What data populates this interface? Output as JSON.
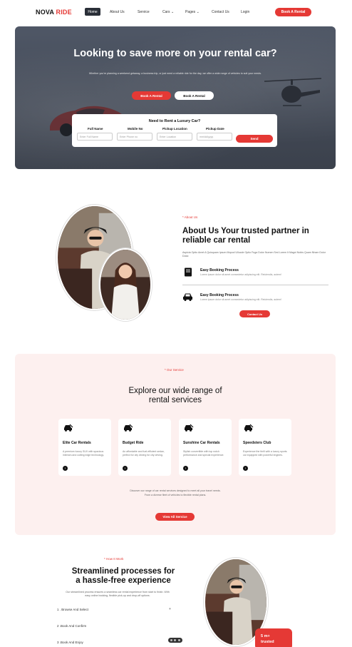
{
  "nav": {
    "logo_main": "NOVA",
    "logo_accent": "RIDE",
    "items": [
      "Home",
      "About Us",
      "Service",
      "Cars",
      "Pages",
      "Contact Us",
      "Login"
    ],
    "cta": "Book A Rental"
  },
  "hero": {
    "title": "Looking to save more on your rental car?",
    "subtitle": "Whether you're planning a weekend getaway, a business trip, or just need a reliable ride for the day, we offer a wide range of vehicles to suit your needs.",
    "btn_primary": "Book A Rental",
    "btn_secondary": "Book A Rental"
  },
  "booking": {
    "title": "Need to Rent a Luxury Car?",
    "fields": [
      {
        "label": "Full Name",
        "placeholder": "Enter Full Name"
      },
      {
        "label": "Mobile No",
        "placeholder": "Enter Phone no"
      },
      {
        "label": "Pickup Location",
        "placeholder": "Enter Location"
      },
      {
        "label": "Pickup Date",
        "placeholder": "mm/dd/yyyy"
      }
    ],
    "submit": "Send"
  },
  "about": {
    "tag": "* About Us",
    "title": "About Us Your trusted partner in reliable car rental",
    "text": "Aspicia Optio Amet A Quisquam Ipsum Mopod Ullucde Optio Fuga Dolor Numen Sed Lorem It Magni Nobis Quam Nham Dolor Dolor.",
    "features": [
      {
        "title": "Easy Booking Process",
        "text": "Lorem ipsum dolor sit amet consectetur adipiscing elit. Reiciendis, autem!"
      },
      {
        "title": "Easy Booking Process",
        "text": "Lorem ipsum dolor sit amet consectetur adipiscing elit. Reiciendis, autem!"
      }
    ],
    "button": "Contact Us"
  },
  "services": {
    "tag": "* Our Service",
    "title_line1": "Explore our wide range of",
    "title_line2": "rental services",
    "cards": [
      {
        "title": "Elite Car Rentals",
        "text": "A premium luxury SUV with spacious interiors and cutting edge technology."
      },
      {
        "title": "Budget Ride",
        "text": "An affordable and fuel-efficient sedan, perfect for city driving for city driving."
      },
      {
        "title": "Sunshine Car Rentals",
        "text": "Stylish convertible with top notch performance and special experience."
      },
      {
        "title": "Speedsters Club",
        "text": "Experience the thrill with a luxury sports car equipped with powerful engines."
      }
    ],
    "desc_line1": "Discover our range of car rental services designed to meet all your travel needs.",
    "desc_line2": "From a diverse fleet of vehicles to flexible rental plans.",
    "button": "View All Service"
  },
  "how": {
    "tag": "* How It Work",
    "title_line1": "Streamlined processes for",
    "title_line2": "a hassle-free experience",
    "desc": "Our streamlined process ensures a seamless car rental experience from start to finish. With easy online booking, flexible pick-up and drop-off options.",
    "steps": [
      "1 . Browse And Select",
      "2 .Book And Confirm",
      "3 .Book And Enjoy"
    ],
    "step_plus": "+",
    "stat_value": "5 m+",
    "stat_label": "trusted"
  },
  "colors": {
    "accent": "#e53935",
    "dark": "#2a2f38",
    "services_bg": "#fdf0ef"
  }
}
